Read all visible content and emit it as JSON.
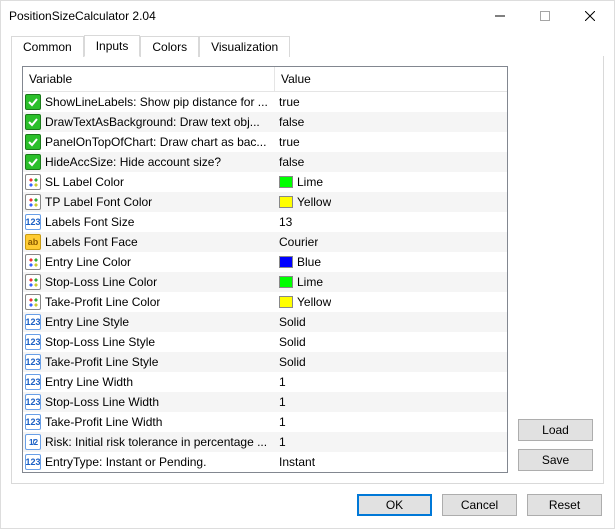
{
  "window": {
    "title": "PositionSizeCalculator 2.04"
  },
  "tabs": {
    "common": "Common",
    "inputs": "Inputs",
    "colors": "Colors",
    "visualization": "Visualization"
  },
  "grid": {
    "headers": {
      "variable": "Variable",
      "value": "Value"
    },
    "rows": [
      {
        "icon": "bool",
        "var": "ShowLineLabels: Show pip distance for ...",
        "val": "true"
      },
      {
        "icon": "bool",
        "var": "DrawTextAsBackground: Draw text obj...",
        "val": "false"
      },
      {
        "icon": "bool",
        "var": "PanelOnTopOfChart: Draw chart as bac...",
        "val": "true"
      },
      {
        "icon": "bool",
        "var": "HideAccSize: Hide account size?",
        "val": "false"
      },
      {
        "icon": "color",
        "var": "SL Label  Color",
        "val": "Lime",
        "swatch": "#00ff00"
      },
      {
        "icon": "color",
        "var": "TP Label Font Color",
        "val": "Yellow",
        "swatch": "#ffff00"
      },
      {
        "icon": "int",
        "var": "Labels Font Size",
        "val": "13"
      },
      {
        "icon": "str",
        "var": "Labels Font Face",
        "val": "Courier"
      },
      {
        "icon": "color",
        "var": "Entry Line Color",
        "val": "Blue",
        "swatch": "#0000ff"
      },
      {
        "icon": "color",
        "var": "Stop-Loss Line Color",
        "val": "Lime",
        "swatch": "#00ff00"
      },
      {
        "icon": "color",
        "var": "Take-Profit Line Color",
        "val": "Yellow",
        "swatch": "#ffff00"
      },
      {
        "icon": "int",
        "var": "Entry Line Style",
        "val": "Solid"
      },
      {
        "icon": "int",
        "var": "Stop-Loss Line Style",
        "val": "Solid"
      },
      {
        "icon": "int",
        "var": "Take-Profit Line Style",
        "val": "Solid"
      },
      {
        "icon": "int",
        "var": "Entry Line Width",
        "val": "1"
      },
      {
        "icon": "int",
        "var": "Stop-Loss Line Width",
        "val": "1"
      },
      {
        "icon": "int",
        "var": "Take-Profit Line Width",
        "val": "1"
      },
      {
        "icon": "frac",
        "var": "Risk: Initial risk tolerance in percentage ...",
        "val": "1"
      },
      {
        "icon": "int",
        "var": "EntryType: Instant or Pending.",
        "val": "Instant"
      }
    ]
  },
  "buttons": {
    "load": "Load",
    "save": "Save",
    "ok": "OK",
    "cancel": "Cancel",
    "reset": "Reset"
  },
  "icon_labels": {
    "int": "123",
    "str": "ab",
    "frac": "1/2"
  }
}
